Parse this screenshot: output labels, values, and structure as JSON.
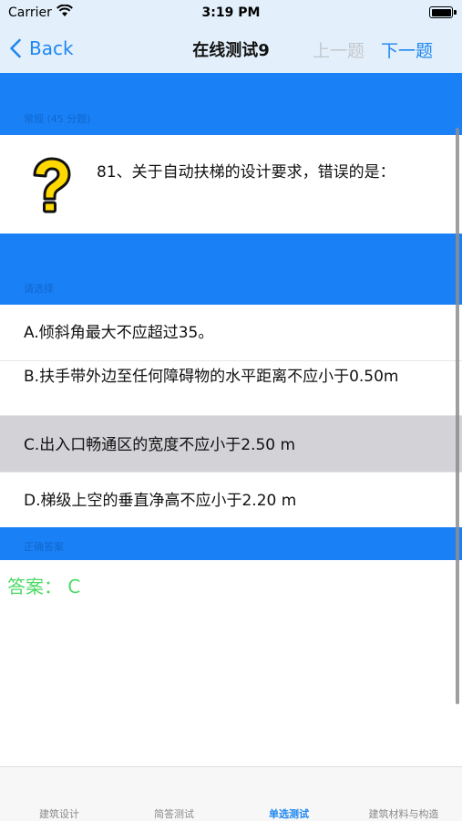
{
  "status_bar": {
    "carrier": "Carrier",
    "time": "3:19 PM"
  },
  "nav": {
    "back_label": "Back",
    "title": "在线测试9",
    "prev_label": "上一题",
    "next_label": "下一题"
  },
  "question_header": "常规 (45 分题)",
  "question": {
    "icon": "question-mark-icon",
    "text": "81、关于自动扶梯的设计要求，错误的是："
  },
  "options_header": "请选择",
  "options": [
    {
      "label": "A.倾斜角最大不应超过35。",
      "selected": false
    },
    {
      "label": "B.扶手带外边至任何障碍物的水平距离不应小于0.50m",
      "selected": false
    },
    {
      "label": "C.出入口畅通区的宽度不应小于2.50 m",
      "selected": true
    },
    {
      "label": "D.梯级上空的垂直净高不应小于2.20 m",
      "selected": false
    }
  ],
  "answer_header": "正确答案",
  "answer": "答案：  C",
  "tabs": [
    {
      "label": "建筑设计",
      "active": false
    },
    {
      "label": "简答测试",
      "active": false
    },
    {
      "label": "单选测试",
      "active": true
    },
    {
      "label": "建筑材料与构造",
      "active": false
    }
  ],
  "colors": {
    "accent": "#1e86f1",
    "band": "#1a80f5",
    "answer": "#4cd964",
    "selected_row": "#d2d2d7"
  }
}
